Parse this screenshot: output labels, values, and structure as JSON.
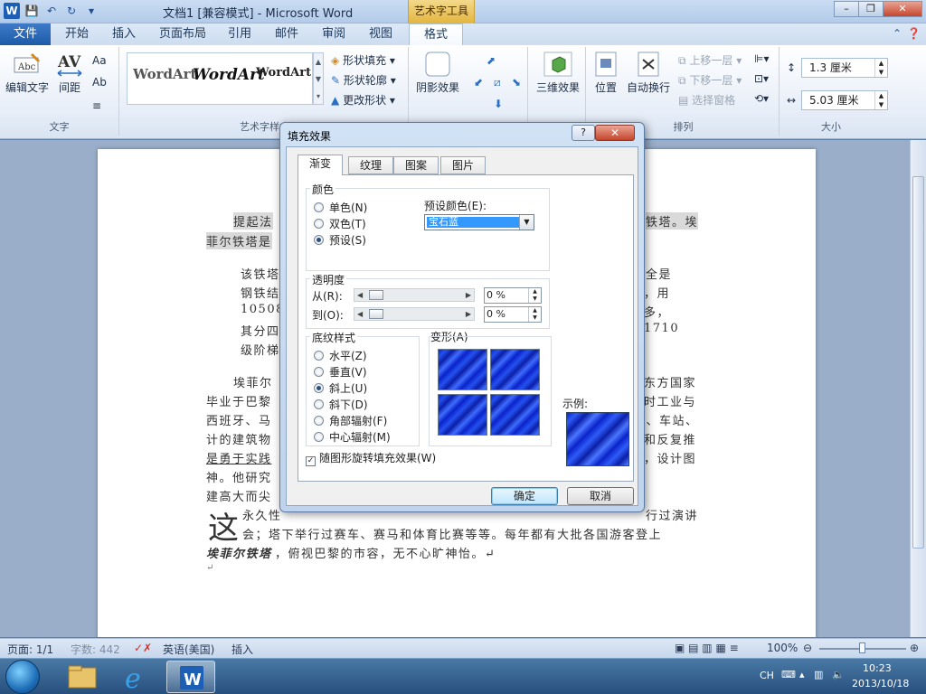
{
  "window": {
    "title": "文档1 [兼容模式] - Microsoft Word",
    "tools_tab_title": "艺术字工具",
    "controls": {
      "minimize": "–",
      "restore": "❐",
      "close": "✕"
    }
  },
  "qat": {
    "logo": "W",
    "save": "💾",
    "undo": "↶",
    "redo": "↻",
    "more": "▾"
  },
  "tabs": {
    "file": "文件",
    "items": [
      "开始",
      "插入",
      "页面布局",
      "引用",
      "邮件",
      "审阅",
      "视图"
    ],
    "active": "格式"
  },
  "ribbon": {
    "text_group": {
      "label": "文字",
      "edit_text": "编辑文字",
      "spacing": "间距",
      "even_height": "Aa",
      "vertical": "Ab",
      "align": "≡"
    },
    "wordart_styles": {
      "label": "艺术字样式",
      "samples": [
        "WordArt",
        "WordArt",
        "WordArt"
      ],
      "shape_fill": "形状填充",
      "shape_outline": "形状轮廓",
      "change_shape": "更改形状"
    },
    "shadow": {
      "label": "阴影效果",
      "button": "阴影效果"
    },
    "three_d": {
      "label": "三维效果",
      "button": "三维效果"
    },
    "arrange": {
      "label": "排列",
      "position": "位置",
      "wrap": "自动换行",
      "bring_forward": "上移一层",
      "send_backward": "下移一层",
      "selection_pane": "选择窗格"
    },
    "size": {
      "label": "大小",
      "height": "1.3 厘米",
      "width": "5.03 厘米"
    }
  },
  "document": {
    "lines": [
      "提起法",
      "菲尔铁塔是",
      "该铁塔",
      "钢铁结",
      "10508",
      "其分四",
      "级阶梯",
      "埃菲尔",
      "毕业于巴黎",
      "西班牙、马",
      "计的建筑物",
      "是勇于实践",
      "神。他研究",
      "建高大而尖",
      "永久性",
      "会；塔下举行过赛车、赛马和体育比赛等等。每年都有大批各国游客登上",
      "，俯视巴黎的市容，无不心旷神怡。↵",
      "↵"
    ],
    "right_fragments": [
      "铁塔。埃",
      "全是",
      "，用",
      "多，",
      "1710",
      "东方国家",
      "时工业与",
      "梁、车站、",
      "和反复推",
      "，设计图",
      "行过演讲"
    ],
    "bold_name": "埃菲尔铁塔",
    "big_char": "这"
  },
  "statusbar": {
    "page": "页面: 1/1",
    "words": "字数: 442",
    "language": "英语(美国)",
    "mode": "插入",
    "zoom": "100%",
    "zoom_level_percent": 100
  },
  "taskbar": {
    "lang": "CH",
    "time": "10:23",
    "date": "2013/10/18"
  },
  "dialog": {
    "title": "填充效果",
    "help": "?",
    "close": "✕",
    "tabs": [
      "渐变",
      "纹理",
      "图案",
      "图片"
    ],
    "active_tab": "渐变",
    "color_legend": "颜色",
    "color_options": [
      "单色(N)",
      "双色(T)",
      "预设(S)"
    ],
    "color_selected": "预设(S)",
    "preset_label": "预设颜色(E):",
    "preset_value": "宝石蓝",
    "transparency_legend": "透明度",
    "from_label": "从(R):",
    "to_label": "到(O):",
    "from_value": "0 %",
    "to_value": "0 %",
    "shading_legend": "底纹样式",
    "shading_options": [
      "水平(Z)",
      "垂直(V)",
      "斜上(U)",
      "斜下(D)",
      "角部辐射(F)",
      "中心辐射(M)"
    ],
    "shading_selected": "斜上(U)",
    "variants_legend": "变形(A)",
    "sample_label": "示例:",
    "rotate_label": "随图形旋转填充效果(W)",
    "ok": "确定",
    "cancel": "取消",
    "colors": {
      "fill_primary": "#0a23c9",
      "fill_highlight": "#3f6cff"
    }
  }
}
